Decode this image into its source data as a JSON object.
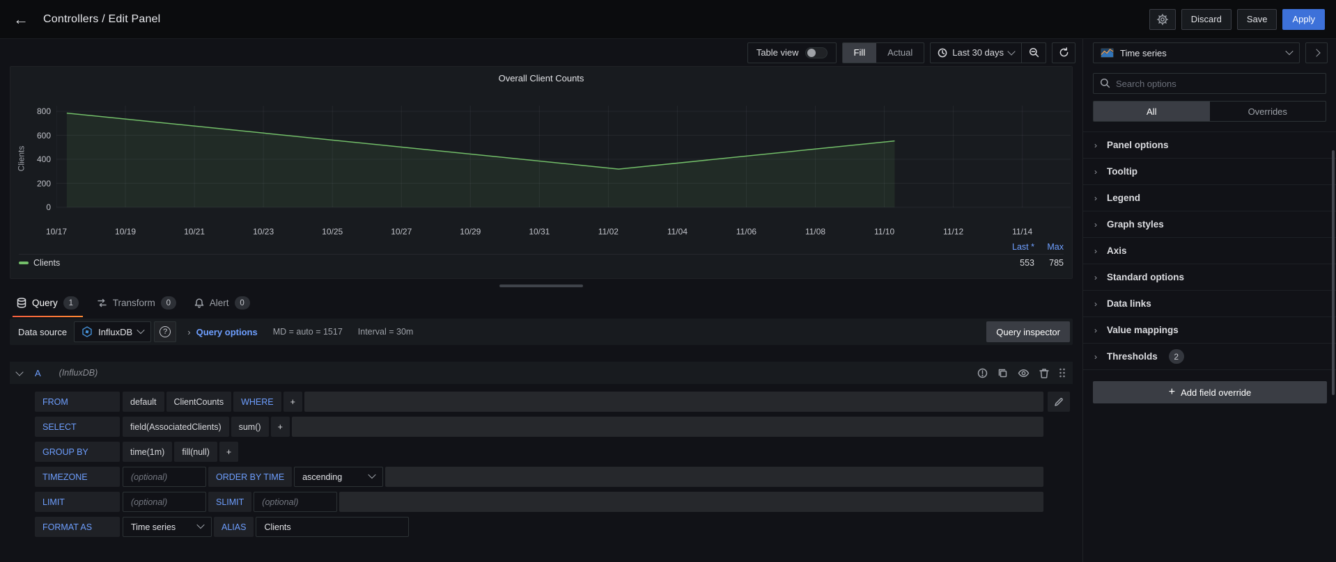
{
  "topnav": {
    "title": "Controllers / Edit Panel",
    "discard_label": "Discard",
    "save_label": "Save",
    "apply_label": "Apply"
  },
  "toolbar": {
    "table_view_label": "Table view",
    "fill_label": "Fill",
    "actual_label": "Actual",
    "time_range_label": "Last 30 days"
  },
  "viz_picker": {
    "selected": "Time series"
  },
  "sidebar": {
    "search_placeholder": "Search options",
    "filter_all": "All",
    "filter_overrides": "Overrides",
    "sections": [
      {
        "label": "Panel options",
        "badge": ""
      },
      {
        "label": "Tooltip",
        "badge": ""
      },
      {
        "label": "Legend",
        "badge": ""
      },
      {
        "label": "Graph styles",
        "badge": ""
      },
      {
        "label": "Axis",
        "badge": ""
      },
      {
        "label": "Standard options",
        "badge": ""
      },
      {
        "label": "Data links",
        "badge": ""
      },
      {
        "label": "Value mappings",
        "badge": ""
      },
      {
        "label": "Thresholds",
        "badge": "2"
      }
    ],
    "add_override_label": "Add field override"
  },
  "panel": {
    "title": "Overall Client Counts",
    "legend_calcs": [
      "Last *",
      "Max"
    ],
    "legend_series": "Clients",
    "legend_values": [
      "553",
      "785"
    ]
  },
  "chart_data": {
    "type": "area",
    "title": "Overall Client Counts",
    "ylabel": "Clients",
    "ylim": [
      0,
      800
    ],
    "yticks": [
      0,
      200,
      400,
      600,
      800
    ],
    "x_tick_labels": [
      "10/17",
      "10/19",
      "10/21",
      "10/23",
      "10/25",
      "10/27",
      "10/29",
      "10/31",
      "11/02",
      "11/04",
      "11/06",
      "11/08",
      "11/10",
      "11/12",
      "11/14"
    ],
    "grid": true,
    "legend_position": "bottom",
    "series": [
      {
        "name": "Clients",
        "color": "#73bf69",
        "fill_opacity": 0.1,
        "points": [
          {
            "x": "10/17",
            "y": 785
          },
          {
            "x": "11/02",
            "y": 318
          },
          {
            "x": "11/10",
            "y": 553
          }
        ],
        "stats": {
          "last": 553,
          "max": 785
        }
      }
    ]
  },
  "edit_tabs": [
    {
      "label": "Query",
      "badge": "1",
      "icon": "database-icon",
      "active": true
    },
    {
      "label": "Transform",
      "badge": "0",
      "icon": "transform-icon",
      "active": false
    },
    {
      "label": "Alert",
      "badge": "0",
      "icon": "bell-icon",
      "active": false
    }
  ],
  "datasource_row": {
    "label": "Data source",
    "datasource": "InfluxDB",
    "query_options_label": "Query options",
    "md_text": "MD = auto = 1517",
    "interval_text": "Interval = 30m",
    "inspector_label": "Query inspector"
  },
  "query": {
    "ref_id": "A",
    "ds_hint": "(InfluxDB)",
    "rows": [
      {
        "name": "from-row",
        "filler": true,
        "pencil": true,
        "segments": [
          {
            "t": "kw",
            "text": "FROM"
          },
          {
            "t": "val",
            "text": "default"
          },
          {
            "t": "val",
            "text": "ClientCounts"
          },
          {
            "t": "kw2",
            "text": "WHERE"
          },
          {
            "t": "plus",
            "text": "+"
          }
        ]
      },
      {
        "name": "select-row",
        "filler": true,
        "pencil": false,
        "segments": [
          {
            "t": "kw",
            "text": "SELECT"
          },
          {
            "t": "val",
            "text": "field(AssociatedClients)"
          },
          {
            "t": "val",
            "text": "sum()"
          },
          {
            "t": "plus",
            "text": "+"
          }
        ]
      },
      {
        "name": "groupby-row",
        "filler": false,
        "pencil": false,
        "segments": [
          {
            "t": "kw",
            "text": "GROUP BY"
          },
          {
            "t": "val",
            "text": "time(1m)"
          },
          {
            "t": "val",
            "text": "fill(null)"
          },
          {
            "t": "plus",
            "text": "+"
          }
        ]
      },
      {
        "name": "timezone-row",
        "filler": true,
        "pencil": false,
        "segments": [
          {
            "t": "kw",
            "text": "TIMEZONE"
          },
          {
            "t": "input",
            "text": "(optional)"
          },
          {
            "t": "kw2",
            "text": "ORDER BY TIME"
          },
          {
            "t": "select",
            "text": "ascending"
          }
        ]
      },
      {
        "name": "limit-row",
        "filler": true,
        "pencil": false,
        "segments": [
          {
            "t": "kw",
            "text": "LIMIT"
          },
          {
            "t": "input",
            "text": "(optional)"
          },
          {
            "t": "kw2",
            "text": "SLIMIT"
          },
          {
            "t": "input",
            "text": "(optional)"
          }
        ]
      },
      {
        "name": "formatas-row",
        "filler": false,
        "pencil": false,
        "segments": [
          {
            "t": "kw",
            "text": "FORMAT AS"
          },
          {
            "t": "select",
            "text": "Time series"
          },
          {
            "t": "kw2",
            "text": "ALIAS"
          },
          {
            "t": "textinput",
            "text": "Clients"
          }
        ]
      }
    ]
  }
}
